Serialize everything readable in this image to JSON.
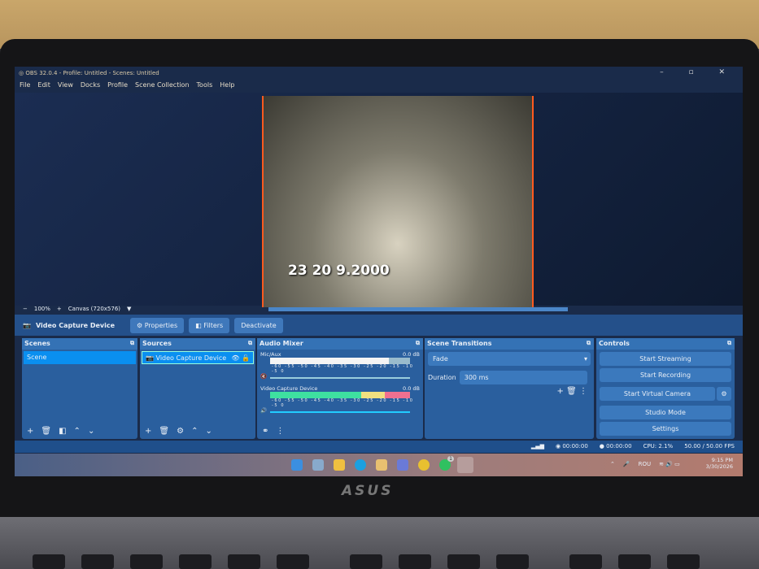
{
  "window": {
    "title": "OBS 32.0.4 - Profile: Untitled - Scenes: Untitled",
    "controls": "– ▫ ✕"
  },
  "menu": [
    "File",
    "Edit",
    "View",
    "Docks",
    "Profile",
    "Scene Collection",
    "Tools",
    "Help"
  ],
  "preview": {
    "video_timestamp": "23 20 9.2000",
    "zoom": "100%",
    "canvas": "Canvas (720x576)"
  },
  "source_toolbar": {
    "source_name": "Video Capture Device",
    "properties": "Properties",
    "filters": "Filters",
    "deactivate": "Deactivate"
  },
  "scenes": {
    "title": "Scenes",
    "items": [
      "Scene"
    ]
  },
  "sources": {
    "title": "Sources",
    "items": [
      "Video Capture Device"
    ]
  },
  "audio_mixer": {
    "title": "Audio Mixer",
    "ticks": "-60 -55 -50 -45 -40 -35 -30 -25 -20 -15 -10 -5 0",
    "channels": [
      {
        "name": "Mic/Aux",
        "db": "0.0 dB",
        "muted": true
      },
      {
        "name": "Video Capture Device",
        "db": "0.0 dB",
        "muted": false
      }
    ]
  },
  "transitions": {
    "title": "Scene Transitions",
    "type": "Fade",
    "duration_label": "Duration",
    "duration": "300 ms"
  },
  "controls": {
    "title": "Controls",
    "buttons": [
      "Start Streaming",
      "Start Recording",
      "Start Virtual Camera",
      "Studio Mode",
      "Settings"
    ]
  },
  "status": {
    "stream_time": "00:00:00",
    "record_time": "00:00:00",
    "cpu": "CPU: 2.1%",
    "fps": "50.00 / 50.00 FPS"
  },
  "taskbar": {
    "lang": "ROU",
    "time": "9:15 PM",
    "date": "3/30/2026",
    "whatsapp_badge": "1"
  },
  "laptop": {
    "brand": "ASUS"
  }
}
